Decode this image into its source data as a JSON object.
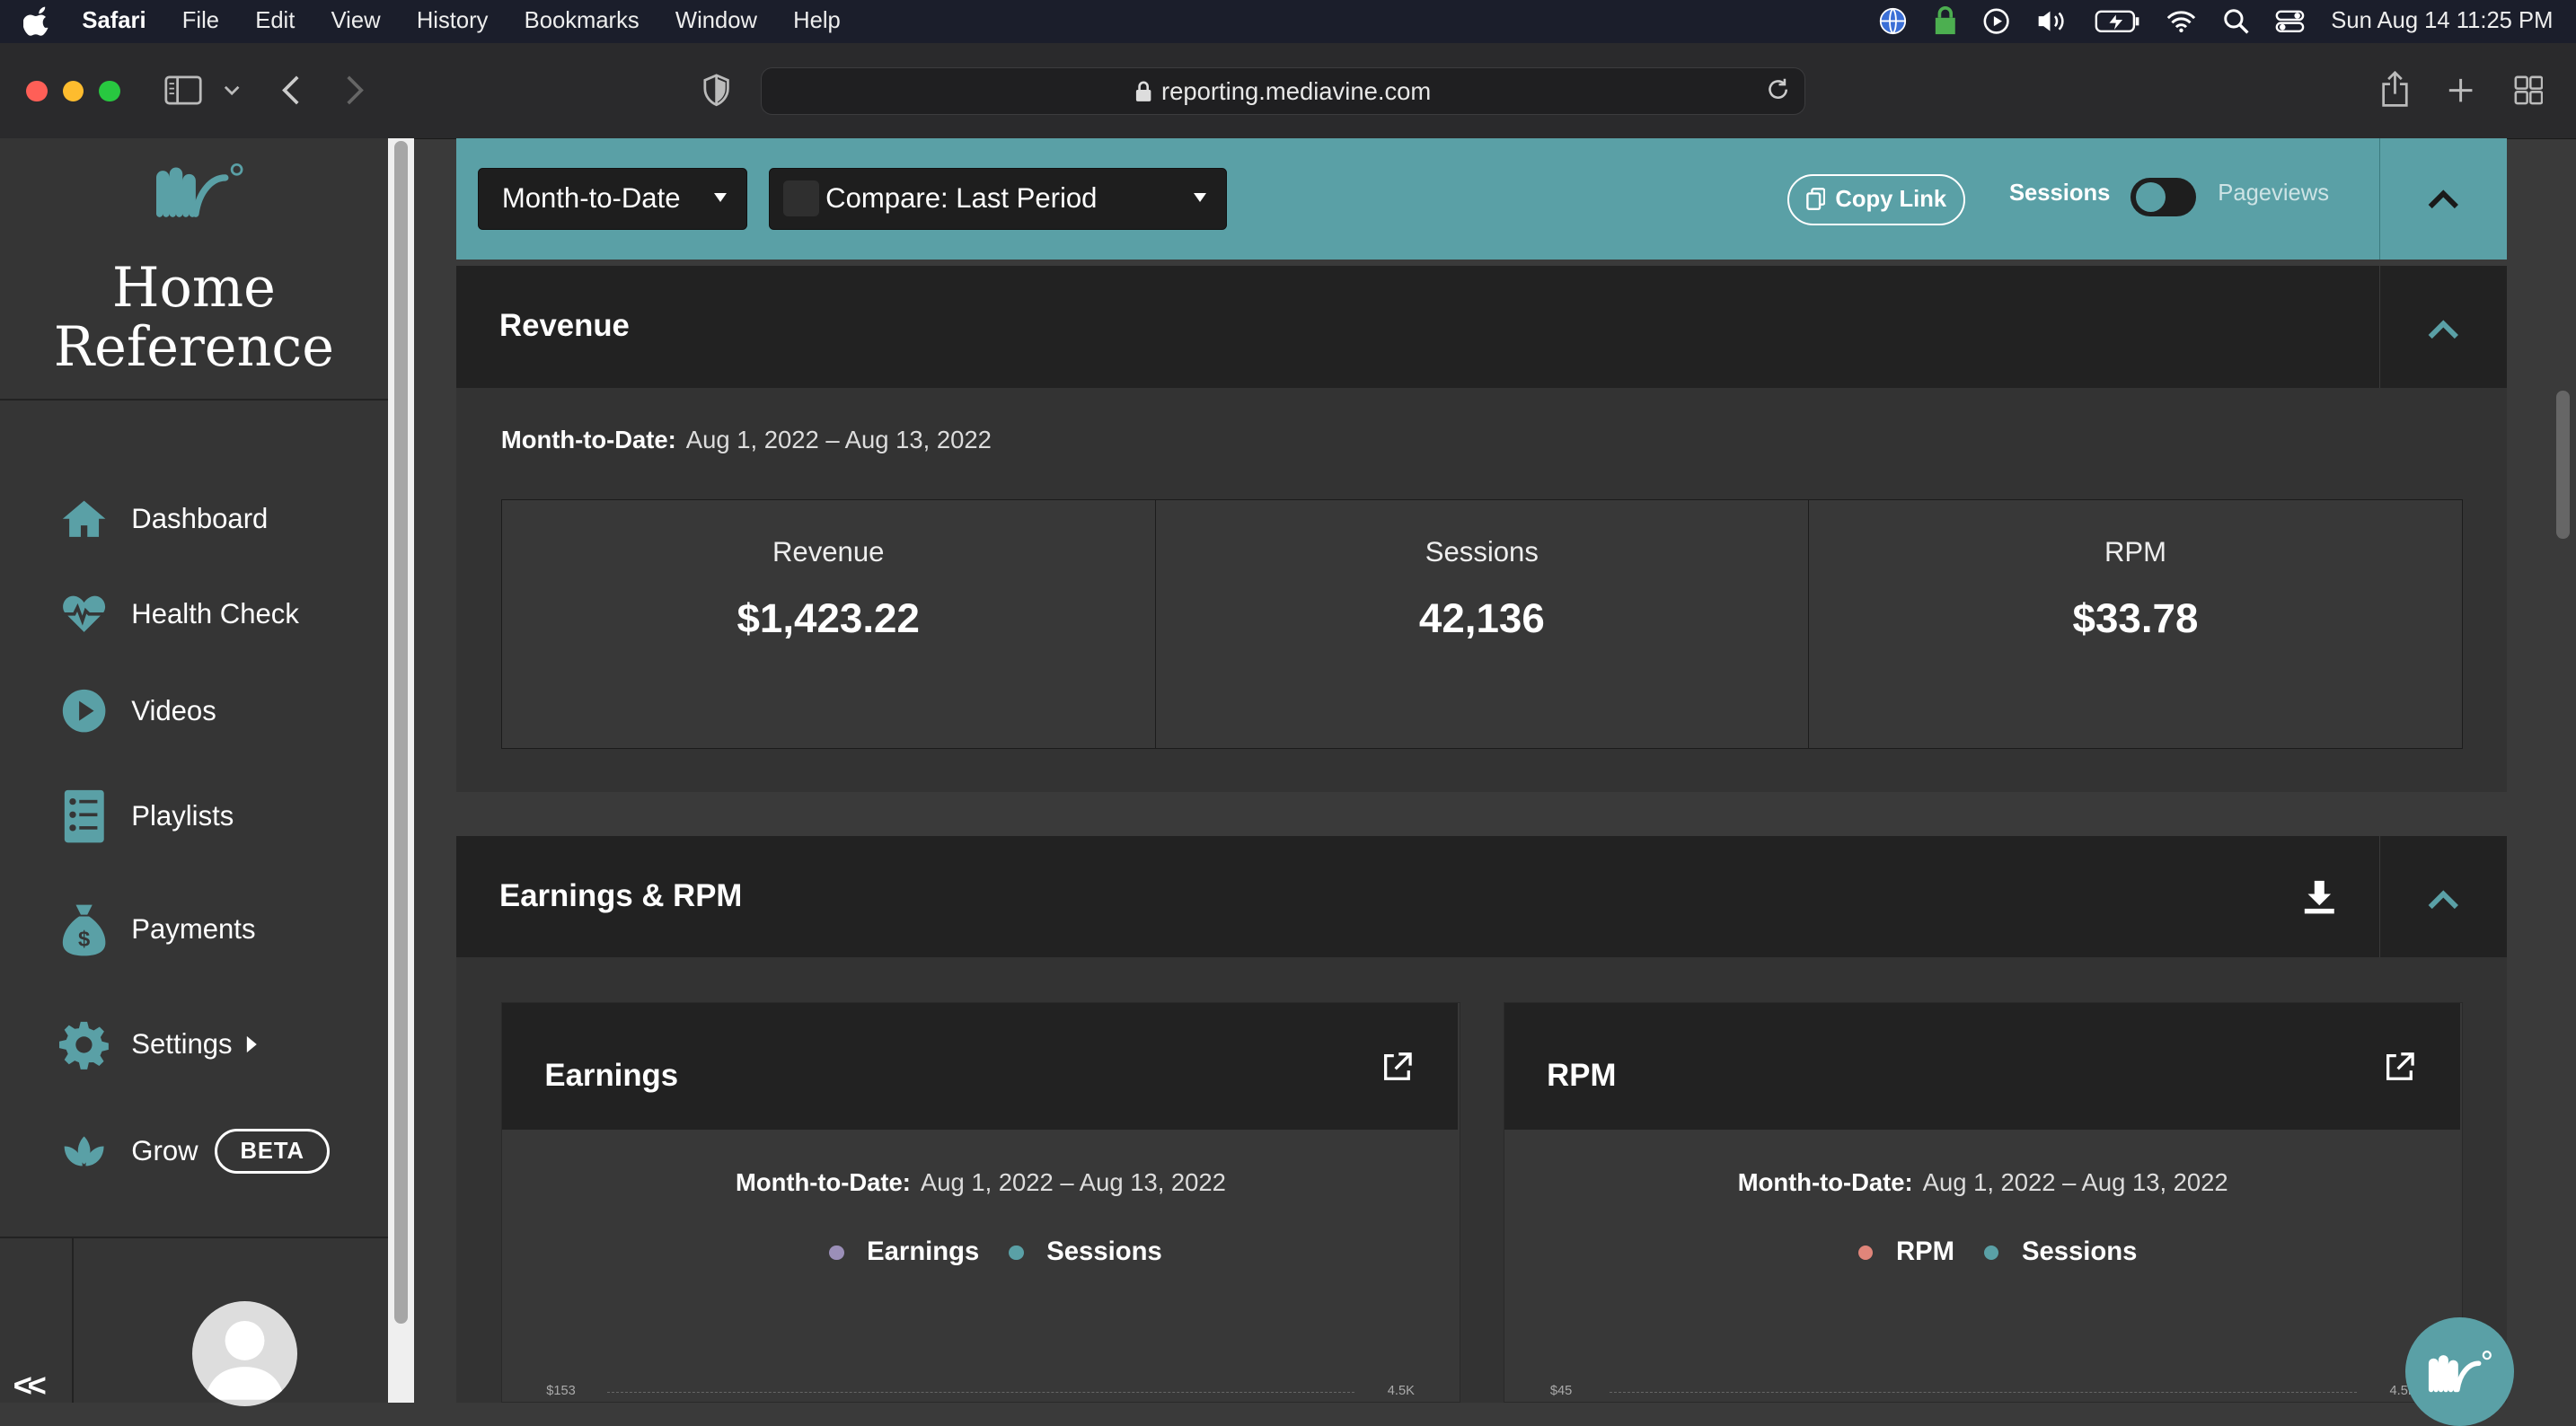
{
  "menubar": {
    "app": "Safari",
    "items": [
      "File",
      "Edit",
      "View",
      "History",
      "Bookmarks",
      "Window",
      "Help"
    ],
    "clock": "Sun Aug 14  11:25 PM"
  },
  "browser": {
    "url": "reporting.mediavine.com"
  },
  "sidebar": {
    "brand_line1": "Home",
    "brand_line2": "Reference",
    "nav": {
      "dashboard": "Dashboard",
      "health": "Health Check",
      "videos": "Videos",
      "playlists": "Playlists",
      "payments": "Payments",
      "settings": "Settings",
      "grow": "Grow",
      "beta": "BETA"
    },
    "collapse": "<<"
  },
  "filters": {
    "period": "Month-to-Date",
    "compare": "Compare: Last Period",
    "copy_link": "Copy Link",
    "toggle_left": "Sessions",
    "toggle_right": "Pageviews"
  },
  "revenue": {
    "title": "Revenue",
    "date_label": "Month-to-Date:",
    "date_range": "Aug 1, 2022 – Aug 13, 2022",
    "stats": [
      {
        "label": "Revenue",
        "value": "$1,423.22"
      },
      {
        "label": "Sessions",
        "value": "42,136"
      },
      {
        "label": "RPM",
        "value": "$33.78"
      }
    ]
  },
  "earnings_rpm": {
    "title": "Earnings & RPM",
    "earnings_card": {
      "title": "Earnings",
      "date_label": "Month-to-Date:",
      "date_range": "Aug 1, 2022 – Aug 13, 2022",
      "legend": [
        "Earnings",
        "Sessions"
      ],
      "y_left_top": "$153",
      "y_right_top": "4.5K"
    },
    "rpm_card": {
      "title": "RPM",
      "date_label": "Month-to-Date:",
      "date_range": "Aug 1, 2022 – Aug 13, 2022",
      "legend": [
        "RPM",
        "Sessions"
      ],
      "y_left_top": "$45",
      "y_right_top": "4.5K"
    }
  },
  "colors": {
    "accent": "#5aa0a6",
    "earnings_dot": "#9b8fb8",
    "sessions_dot": "#5aa0a6",
    "rpm_dot": "#e0857a"
  }
}
